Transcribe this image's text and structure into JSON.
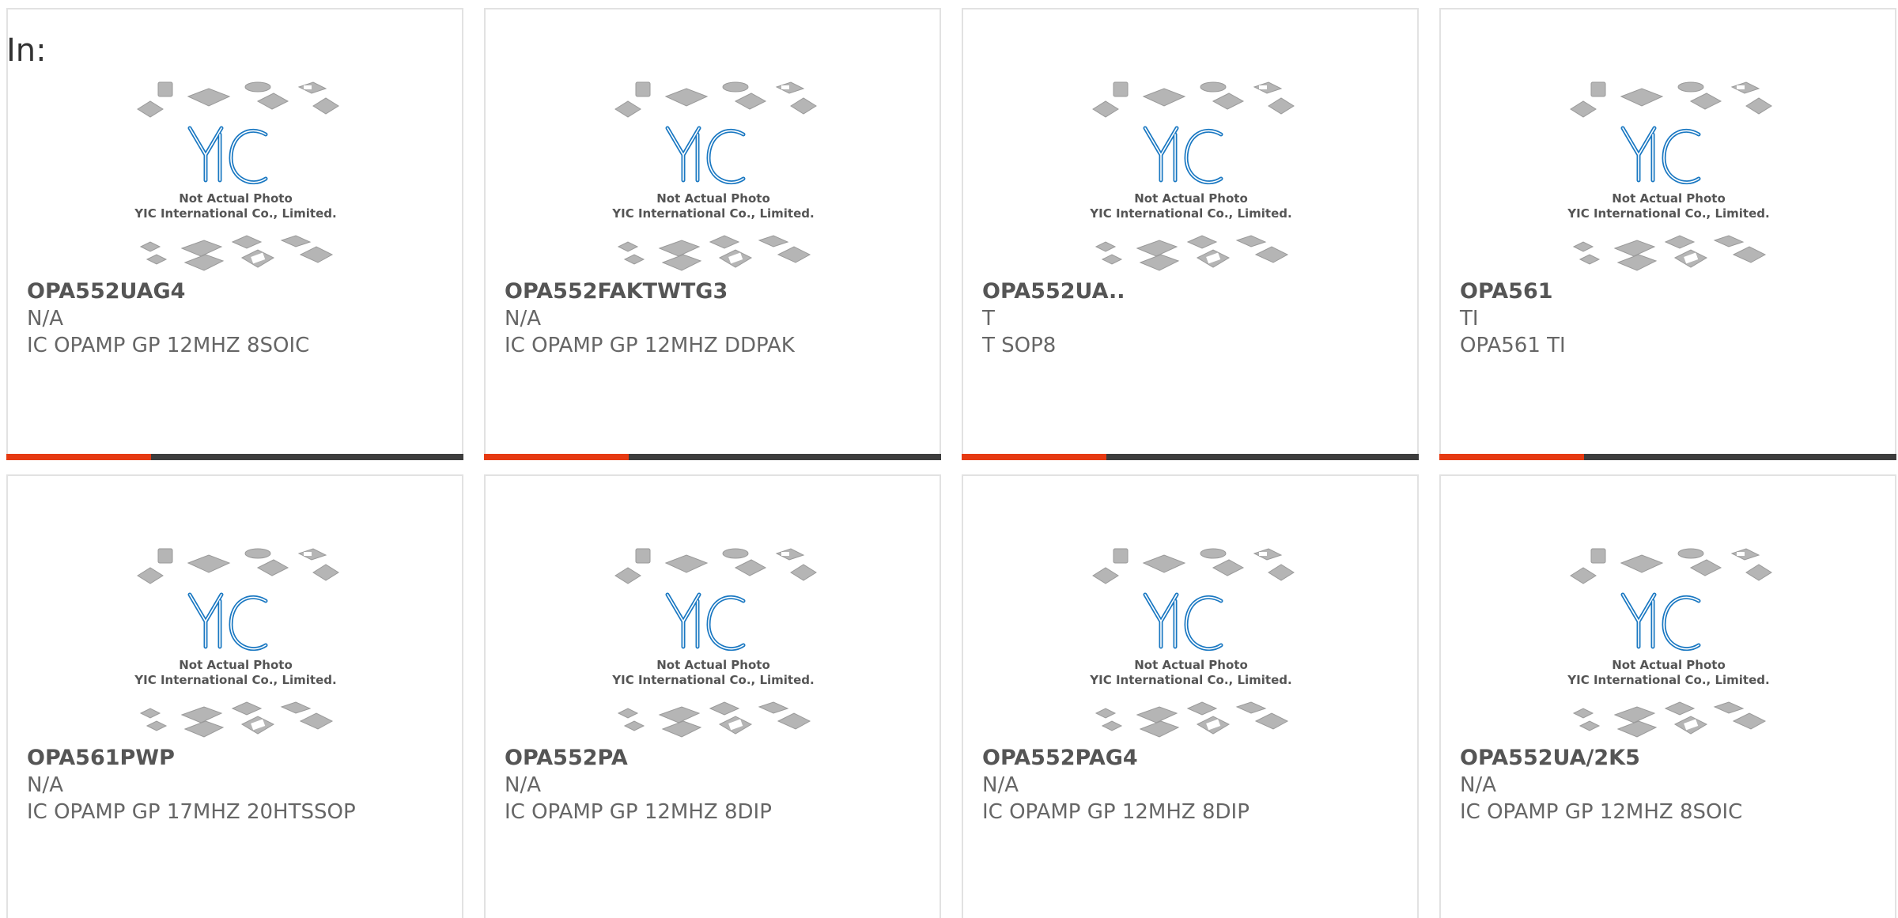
{
  "header": {
    "in_label": "In:"
  },
  "placeholder": {
    "line1": "Not Actual Photo",
    "line2": "YIC International Co., Limited.",
    "logo_text": "YIC",
    "colors": {
      "logo": "#1a78c2",
      "chip": "#b5b5b5",
      "accent": "#e63a12",
      "bar": "#3d3d3d"
    }
  },
  "products": [
    {
      "part": "OPA552UAG4",
      "manufacturer": "N/A",
      "description": "IC OPAMP GP 12MHZ 8SOIC"
    },
    {
      "part": "OPA552FAKTWTG3",
      "manufacturer": "N/A",
      "description": "IC OPAMP GP 12MHZ DDPAK"
    },
    {
      "part": "OPA552UA..",
      "manufacturer": "T",
      "description": "T SOP8"
    },
    {
      "part": "OPA561",
      "manufacturer": "TI",
      "description": "OPA561 TI"
    },
    {
      "part": "OPA561PWP",
      "manufacturer": "N/A",
      "description": "IC OPAMP GP 17MHZ 20HTSSOP"
    },
    {
      "part": "OPA552PA",
      "manufacturer": "N/A",
      "description": "IC OPAMP GP 12MHZ 8DIP"
    },
    {
      "part": "OPA552PAG4",
      "manufacturer": "N/A",
      "description": "IC OPAMP GP 12MHZ 8DIP"
    },
    {
      "part": "OPA552UA/2K5",
      "manufacturer": "N/A",
      "description": "IC OPAMP GP 12MHZ 8SOIC"
    }
  ]
}
